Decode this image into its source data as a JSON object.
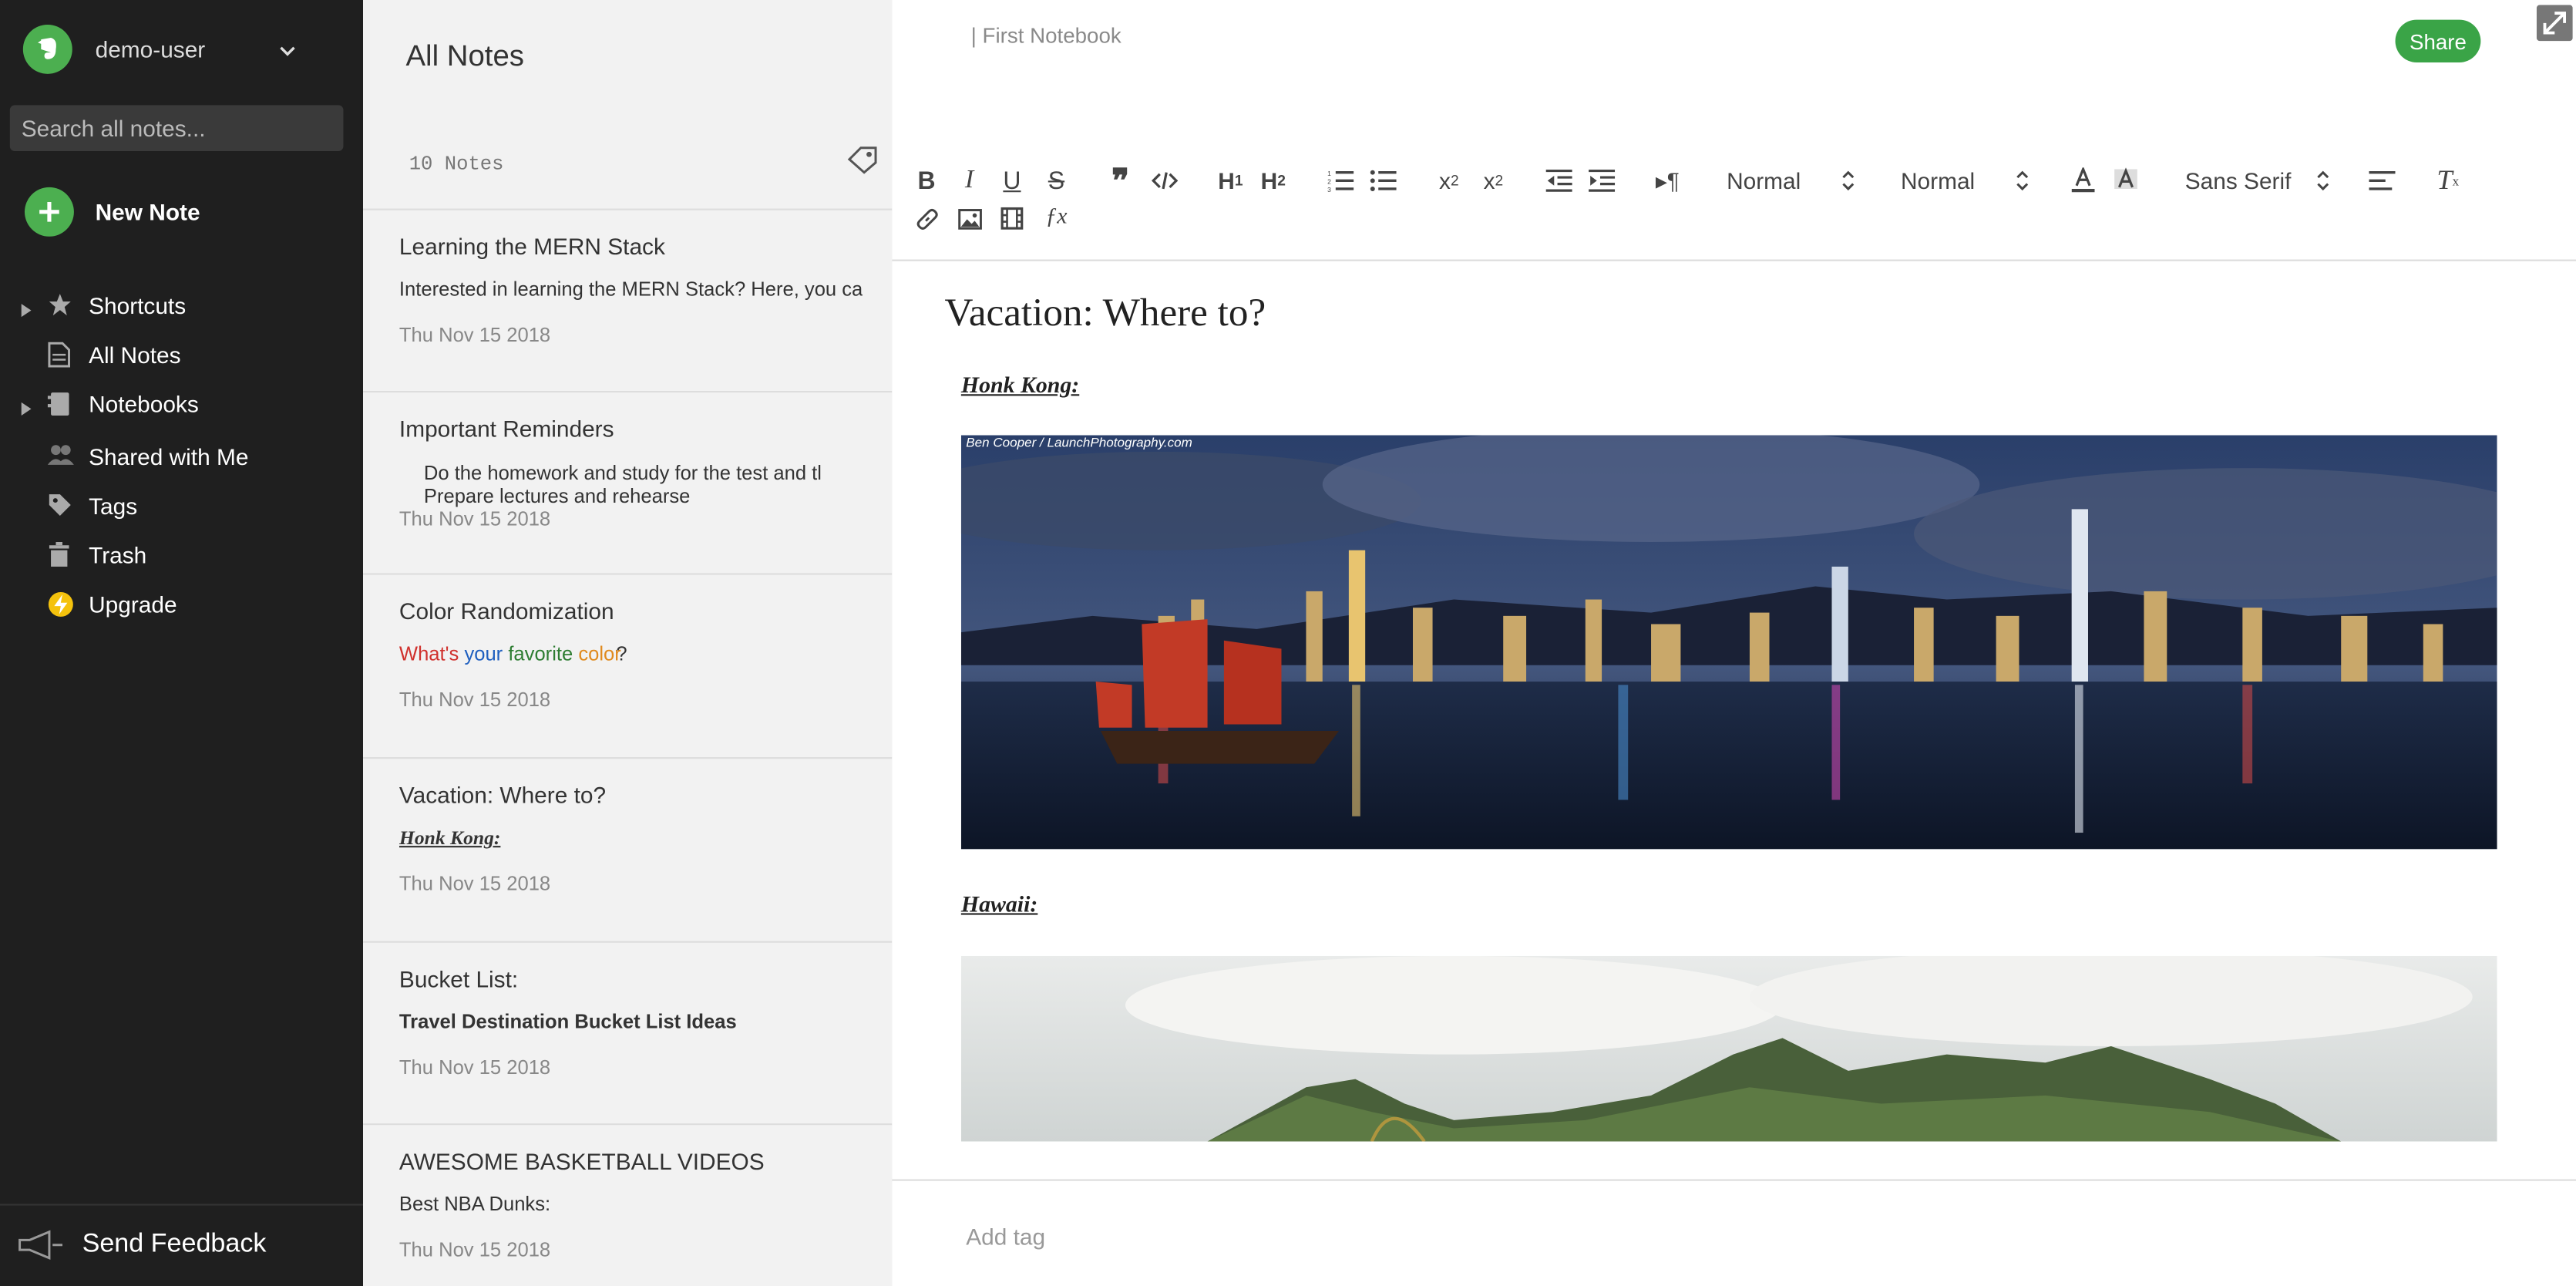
{
  "sidebar": {
    "user_name": "demo-user",
    "search_placeholder": "Search all notes...",
    "new_note_label": "New Note",
    "nav": [
      {
        "label": "Shortcuts",
        "icon": "star-icon"
      },
      {
        "label": "All Notes",
        "icon": "notes-icon"
      },
      {
        "label": "Notebooks",
        "icon": "notebook-icon"
      },
      {
        "label": "Shared with Me",
        "icon": "shared-icon"
      },
      {
        "label": "Tags",
        "icon": "tag-icon"
      },
      {
        "label": "Trash",
        "icon": "trash-icon"
      },
      {
        "label": "Upgrade",
        "icon": "upgrade-icon"
      }
    ],
    "feedback_label": "Send Feedback"
  },
  "notelist": {
    "title": "All Notes",
    "count": "10 Notes",
    "notes": [
      {
        "title": "Learning the MERN Stack",
        "snippet": "Interested in learning the MERN Stack? Here, you car",
        "date": "Thu Nov 15 2018"
      },
      {
        "title": "Important Reminders",
        "bullets": [
          "Do the homework and study for the test and tl",
          "Prepare lectures and rehearse"
        ],
        "date": "Thu Nov 15 2018"
      },
      {
        "title": "Color Randomization",
        "snippet_words": [
          "What's",
          "your",
          "favorite",
          "color",
          "?"
        ],
        "date": "Thu Nov 15 2018"
      },
      {
        "title": "Vacation: Where to?",
        "snippet": "Honk Kong:",
        "date": "Thu Nov 15 2018"
      },
      {
        "title": "Bucket List:",
        "snippet": "Travel Destination Bucket List Ideas",
        "date": "Thu Nov 15 2018"
      },
      {
        "title": "AWESOME BASKETBALL VIDEOS",
        "snippet": "Best NBA Dunks:",
        "date": "Thu Nov 15 2018"
      }
    ]
  },
  "editor": {
    "notebook": "| First Notebook",
    "share_label": "Share",
    "toolbar": {
      "header_select": "Normal",
      "size_select": "Normal",
      "font_select": "Sans Serif"
    },
    "note_title": "Vacation: Where to?",
    "section1": "Honk Kong:",
    "image_credit": "Ben Cooper / LaunchPhotography.com",
    "section2": "Hawaii:",
    "add_tag": "Add tag"
  },
  "colors": {
    "sidebar_bg": "#1f1f1f",
    "accent_green": "#4caf50",
    "share_green": "#3aa447",
    "snippet_red": "#d0312d",
    "snippet_blue": "#1f5fbf",
    "snippet_green": "#2e7d32",
    "snippet_orange": "#e08a1e"
  }
}
